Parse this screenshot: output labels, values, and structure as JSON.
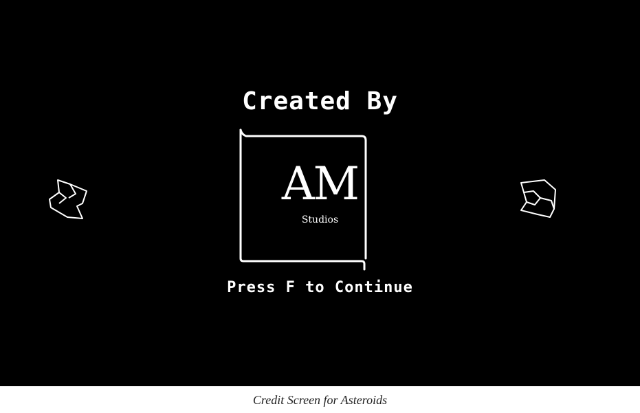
{
  "screen": {
    "title": "Created By",
    "prompt": "Press F to Continue"
  },
  "logo": {
    "initials": "AM",
    "subtitle": "Studios"
  },
  "caption": "Credit Screen for Asteroids",
  "colors": {
    "background": "#000000",
    "foreground": "#ffffff",
    "page": "#ffffff"
  },
  "icons": {
    "asteroid_left": "asteroid-outline",
    "asteroid_right": "asteroid-outline"
  }
}
